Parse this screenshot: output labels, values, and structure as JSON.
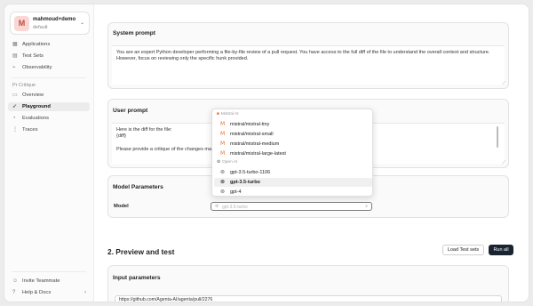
{
  "workspace": {
    "avatar": "M",
    "name": "mahmoud+demo",
    "subtitle": "default"
  },
  "sidebar": {
    "items": [
      {
        "label": "Applications",
        "icon": "grid-icon"
      },
      {
        "label": "Test Sets",
        "icon": "table-icon"
      },
      {
        "label": "Observability",
        "icon": "chart-icon"
      }
    ],
    "section": "Pr Critique",
    "app_items": [
      {
        "label": "Overview",
        "icon": "monitor-icon"
      },
      {
        "label": "Playground",
        "icon": "rocket-icon"
      },
      {
        "label": "Evaluations",
        "icon": "gauge-icon"
      },
      {
        "label": "Traces",
        "icon": "tree-icon"
      }
    ],
    "footer": [
      {
        "label": "Invite Teammate",
        "icon": "user-plus-icon"
      },
      {
        "label": "Help & Docs",
        "icon": "help-icon"
      }
    ]
  },
  "system_prompt": {
    "title": "System prompt",
    "text": "You are an expert Python developer performing a file-by-file review of a pull request. You have access to the full diff of the file to understand the overall context and structure. However, focus on reviewing only the specific hunk provided."
  },
  "user_prompt": {
    "title": "User prompt",
    "line1": "Here is the diff for the file:",
    "line2": "{diff}",
    "line3": "Please provide a critique of the changes made in"
  },
  "model_params": {
    "title": "Model Parameters",
    "model_label": "Model",
    "model_placeholder": "gpt-3.5-turbo"
  },
  "dropdown": {
    "groups": [
      {
        "name": "Mistral AI",
        "options": [
          "mistral/mistral-tiny",
          "mistral/mistral-small",
          "mistral/mistral-medium",
          "mistral/mistral-large-latest"
        ]
      },
      {
        "name": "Open AI",
        "options": [
          "gpt-3.5-turbo-1106",
          "gpt-3.5-turbo",
          "gpt-4"
        ]
      }
    ],
    "selected": "gpt-3.5-turbo"
  },
  "preview": {
    "title": "2. Preview and test",
    "load_button": "Load Test sets",
    "run_button": "Run all",
    "input_params_title": "Input parameters",
    "input_value": "https://github.com/Agenta-AI/agenta/pull/2276"
  }
}
